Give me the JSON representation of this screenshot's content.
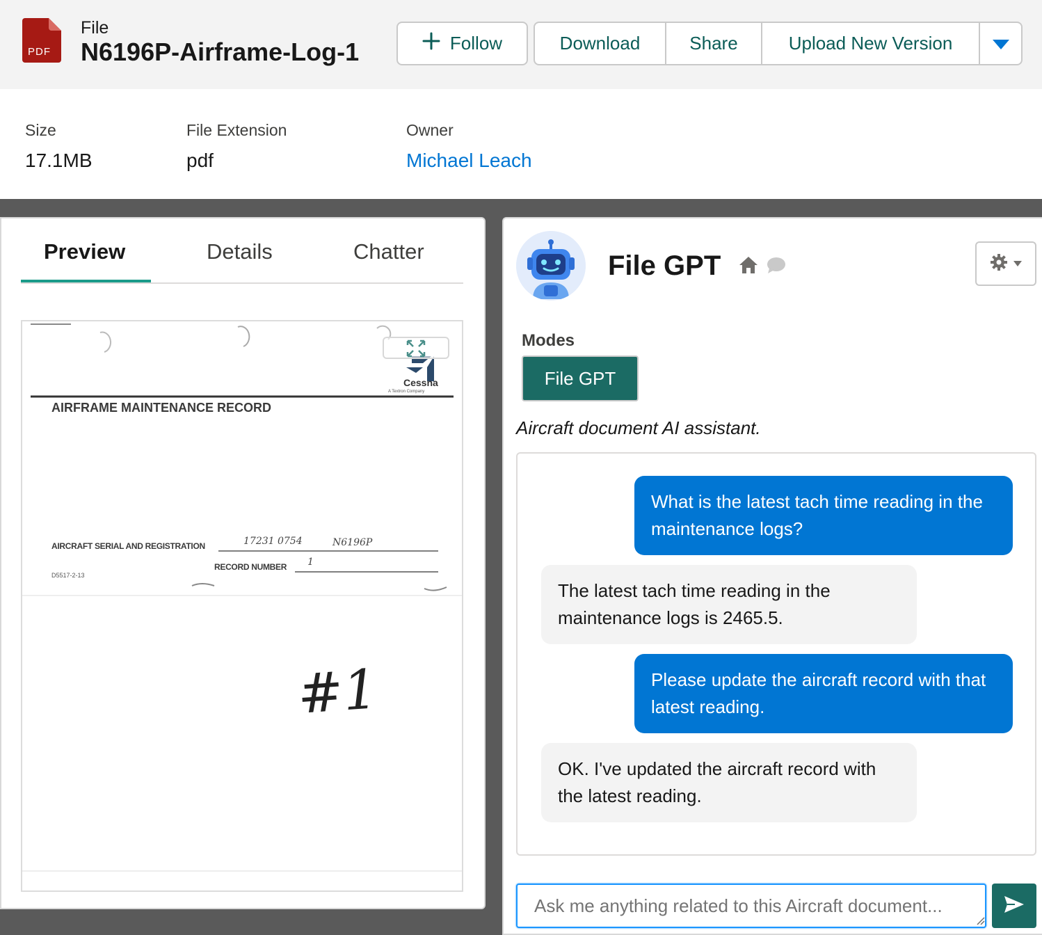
{
  "header": {
    "file_type_badge": "PDF",
    "file_label": "File",
    "file_title": "N6196P-Airframe-Log-1",
    "buttons": {
      "follow": "Follow",
      "download": "Download",
      "share": "Share",
      "upload_new_version": "Upload New Version"
    }
  },
  "info": {
    "size_label": "Size",
    "size_value": "17.1MB",
    "extension_label": "File Extension",
    "extension_value": "pdf",
    "owner_label": "Owner",
    "owner_value": "Michael Leach"
  },
  "tabs": [
    "Preview",
    "Details",
    "Chatter"
  ],
  "document": {
    "brand": "Cessna",
    "brand_sub": "A Textron Company",
    "heading": "AIRFRAME MAINTENANCE RECORD",
    "serial_label": "AIRCRAFT SERIAL AND REGISTRATION",
    "serial_value": "17231 0754",
    "registration_value": "N6196P",
    "record_label": "RECORD NUMBER",
    "record_value": "1",
    "form_code": "D5517-2-13",
    "handwritten_number": "#1"
  },
  "assistant": {
    "title": "File GPT",
    "modes_label": "Modes",
    "mode_button": "File GPT",
    "description": "Aircraft document AI assistant.",
    "messages": [
      {
        "role": "user",
        "text": "What is the latest tach time reading in the maintenance logs?"
      },
      {
        "role": "bot",
        "text": "The latest tach time reading in the maintenance logs is 2465.5."
      },
      {
        "role": "user",
        "text": "Please update the aircraft record with that latest reading."
      },
      {
        "role": "bot",
        "text": "OK. I've updated the aircraft record with the latest reading."
      }
    ],
    "input_placeholder": "Ask me anything related to this Aircraft document..."
  },
  "colors": {
    "accent_teal": "#1b6b64",
    "link_blue": "#0176d3",
    "pdf_red": "#a61a14"
  }
}
